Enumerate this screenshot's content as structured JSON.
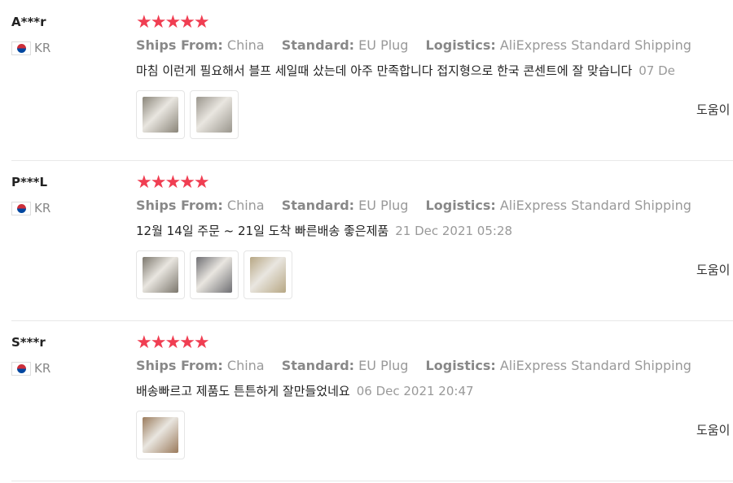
{
  "reviews": [
    {
      "user": "A***r",
      "country": "KR",
      "stars": "★★★★★",
      "ships_from_label": "Ships From:",
      "ships_from": "China",
      "standard_label": "Standard:",
      "standard": "EU Plug",
      "logistics_label": "Logistics:",
      "logistics": "AliExpress Standard Shipping",
      "text": "마침 이런게 필요해서 블프 세일때 샀는데 아주 만족합니다 접지형으로 한국 콘센트에 잘 맞습니다",
      "date": "07 De",
      "helpful": "도움이",
      "thumbs": [
        {
          "name": "photo-1",
          "color": "#8a8579"
        },
        {
          "name": "photo-2",
          "color": "#9a968d"
        }
      ]
    },
    {
      "user": "P***L",
      "country": "KR",
      "stars": "★★★★★",
      "ships_from_label": "Ships From:",
      "ships_from": "China",
      "standard_label": "Standard:",
      "standard": "EU Plug",
      "logistics_label": "Logistics:",
      "logistics": "AliExpress Standard Shipping",
      "text": "12월 14일 주문 ~ 21일 도착 빠른배송 좋은제품",
      "date": "21 Dec 2021 05:28",
      "helpful": "도움이",
      "thumbs": [
        {
          "name": "photo-1",
          "color": "#7c776d"
        },
        {
          "name": "photo-2",
          "color": "#6f6f73"
        },
        {
          "name": "photo-3",
          "color": "#b7a784"
        }
      ]
    },
    {
      "user": "S***r",
      "country": "KR",
      "stars": "★★★★★",
      "ships_from_label": "Ships From:",
      "ships_from": "China",
      "standard_label": "Standard:",
      "standard": "EU Plug",
      "logistics_label": "Logistics:",
      "logistics": "AliExpress Standard Shipping",
      "text": "배송빠르고 제품도 튼튼하게 잘만들었네요",
      "date": "06 Dec 2021 20:47",
      "helpful": "도움이",
      "thumbs": [
        {
          "name": "photo-1",
          "color": "#9b7b5c"
        }
      ]
    }
  ],
  "colors": {
    "star": "#f03e52",
    "muted": "#999999"
  }
}
